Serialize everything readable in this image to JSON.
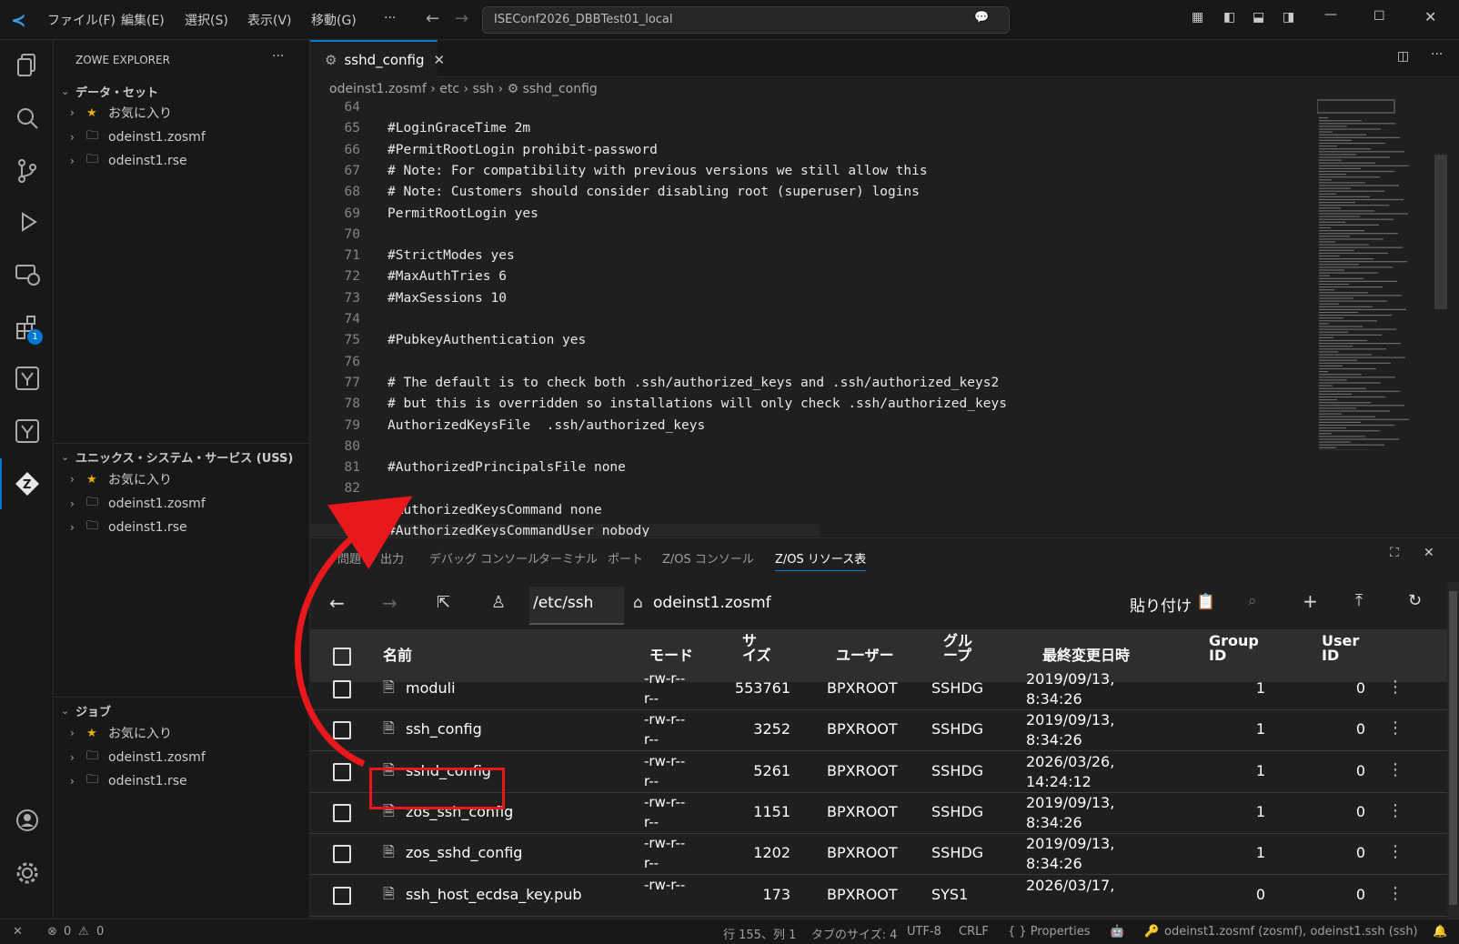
{
  "title_bar": {
    "menus": [
      "ファイル(F)",
      "編集(E)",
      "選択(S)",
      "表示(V)",
      "移動(G)",
      "···"
    ],
    "search_text": "ISEConf2026_DBBTest01_local"
  },
  "sidebar": {
    "title": "ZOWE EXPLORER",
    "more": "···",
    "sections": [
      {
        "label": "データ・セット",
        "items": [
          "お気に入り",
          "odeinst1.zosmf",
          "odeinst1.rse"
        ]
      },
      {
        "label": "ユニックス・システム・サービス (USS)",
        "items": [
          "お気に入り",
          "odeinst1.zosmf",
          "odeinst1.rse"
        ]
      },
      {
        "label": "ジョブ",
        "items": [
          "お気に入り",
          "odeinst1.zosmf",
          "odeinst1.rse"
        ]
      }
    ]
  },
  "activity_badge": "1",
  "editor": {
    "tab_label": "sshd_config",
    "breadcrumb": [
      "odeinst1.zosmf",
      "etc",
      "ssh",
      "sshd_config"
    ],
    "lines": [
      {
        "n": "64",
        "text": ""
      },
      {
        "n": "65",
        "text": "#LoginGraceTime 2m"
      },
      {
        "n": "66",
        "text": "#PermitRootLogin prohibit-password"
      },
      {
        "n": "67",
        "text": "# Note: For compatibility with previous versions we still allow this"
      },
      {
        "n": "68",
        "text": "# Note: Customers should consider disabling root (superuser) logins"
      },
      {
        "n": "69",
        "text": "PermitRootLogin yes"
      },
      {
        "n": "70",
        "text": ""
      },
      {
        "n": "71",
        "text": "#StrictModes yes"
      },
      {
        "n": "72",
        "text": "#MaxAuthTries 6"
      },
      {
        "n": "73",
        "text": "#MaxSessions 10"
      },
      {
        "n": "74",
        "text": ""
      },
      {
        "n": "75",
        "text": "#PubkeyAuthentication yes"
      },
      {
        "n": "76",
        "text": ""
      },
      {
        "n": "77",
        "text": "# The default is to check both .ssh/authorized_keys and .ssh/authorized_keys2"
      },
      {
        "n": "78",
        "text": "# but this is overridden so installations will only check .ssh/authorized_keys"
      },
      {
        "n": "79",
        "text": "AuthorizedKeysFile  .ssh/authorized_keys"
      },
      {
        "n": "80",
        "text": ""
      },
      {
        "n": "81",
        "text": "#AuthorizedPrincipalsFile none"
      },
      {
        "n": "82",
        "text": ""
      },
      {
        "n": "83",
        "text": "#AuthorizedKeysCommand none"
      },
      {
        "n": "84",
        "text": "#AuthorizedKeysCommandUser nobody"
      }
    ]
  },
  "panel": {
    "tabs": [
      "問題",
      "出力",
      "デバッグ コンソール",
      "ターミナル",
      "ポート",
      "Z/OS コンソール",
      "Z/OS リソース表"
    ],
    "path": "/etc/ssh",
    "host": "odeinst1.zosmf",
    "paste_label": "貼り付け",
    "columns": [
      "名前",
      "モード",
      "サイズ",
      "ユーザー",
      "グループ",
      "最終変更日時",
      "Group ID",
      "User ID"
    ],
    "rows": [
      {
        "name": "moduli",
        "mode1": "-rw-r--",
        "mode2": "r--",
        "size": "553761",
        "user": "BPXROOT",
        "group": "SSHDG",
        "date1": "2019/09/13,",
        "date2": "8:34:26",
        "gid": "1",
        "uid": "0"
      },
      {
        "name": "ssh_config",
        "mode1": "-rw-r--",
        "mode2": "r--",
        "size": "3252",
        "user": "BPXROOT",
        "group": "SSHDG",
        "date1": "2019/09/13,",
        "date2": "8:34:26",
        "gid": "1",
        "uid": "0"
      },
      {
        "name": "sshd_config",
        "mode1": "-rw-r--",
        "mode2": "r--",
        "size": "5261",
        "user": "BPXROOT",
        "group": "SSHDG",
        "date1": "2026/03/26,",
        "date2": "14:24:12",
        "gid": "1",
        "uid": "0"
      },
      {
        "name": "zos_ssh_config",
        "mode1": "-rw-r--",
        "mode2": "r--",
        "size": "1151",
        "user": "BPXROOT",
        "group": "SSHDG",
        "date1": "2019/09/13,",
        "date2": "8:34:26",
        "gid": "1",
        "uid": "0"
      },
      {
        "name": "zos_sshd_config",
        "mode1": "-rw-r--",
        "mode2": "r--",
        "size": "1202",
        "user": "BPXROOT",
        "group": "SSHDG",
        "date1": "2019/09/13,",
        "date2": "8:34:26",
        "gid": "1",
        "uid": "0"
      },
      {
        "name": "ssh_host_ecdsa_key.pub",
        "mode1": "-rw-r--",
        "mode2": "",
        "size": "173",
        "user": "BPXROOT",
        "group": "SYS1",
        "date1": "2026/03/17,",
        "date2": "",
        "gid": "0",
        "uid": "0"
      }
    ]
  },
  "status_bar": {
    "errors": "0",
    "warnings": "0",
    "position": "行 155、列 1",
    "tab_size": "タブのサイズ: 4",
    "encoding": "UTF-8",
    "eol": "CRLF",
    "language": "{ } Properties",
    "connection": "odeinst1.zosmf (zosmf), odeinst1.ssh (ssh)"
  },
  "colors": {
    "accent": "#0078d4",
    "highlight": "#e8181c"
  }
}
